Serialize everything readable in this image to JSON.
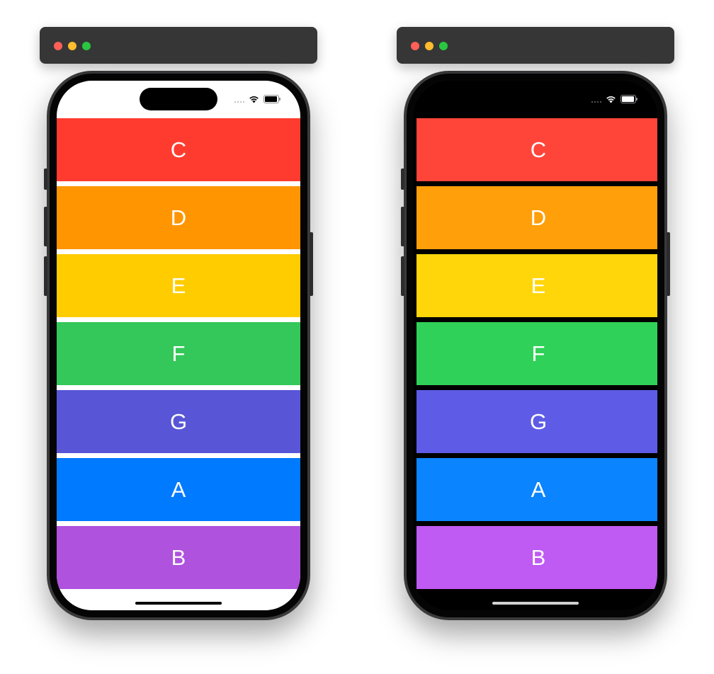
{
  "light_device": {
    "rows": [
      {
        "label": "C",
        "color": "#ff3b30"
      },
      {
        "label": "D",
        "color": "#ff9500"
      },
      {
        "label": "E",
        "color": "#ffcc00"
      },
      {
        "label": "F",
        "color": "#34c759"
      },
      {
        "label": "G",
        "color": "#5856d6"
      },
      {
        "label": "A",
        "color": "#007aff"
      },
      {
        "label": "B",
        "color": "#af52de"
      }
    ]
  },
  "dark_device": {
    "rows": [
      {
        "label": "C",
        "color": "#ff453a"
      },
      {
        "label": "D",
        "color": "#ff9f0a"
      },
      {
        "label": "E",
        "color": "#ffd60a"
      },
      {
        "label": "F",
        "color": "#30d158"
      },
      {
        "label": "G",
        "color": "#5e5ce6"
      },
      {
        "label": "A",
        "color": "#0a84ff"
      },
      {
        "label": "B",
        "color": "#bf5af2"
      }
    ]
  },
  "icons": {
    "window_controls": [
      "close-icon",
      "minimize-icon",
      "zoom-icon"
    ],
    "status_bar": [
      "cellular-signal-icon",
      "wifi-icon",
      "battery-icon"
    ]
  }
}
